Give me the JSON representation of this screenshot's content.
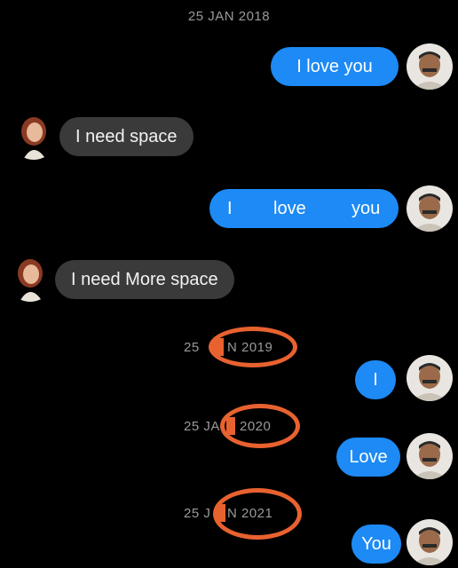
{
  "timestamps": {
    "t2018": "25 JAN 2018",
    "t2019_left": "25",
    "t2019_right": "N 2019",
    "t2020_left": "25 JA",
    "t2020_right": "2020",
    "t2021_left": "25 J",
    "t2021_right": "N 2021"
  },
  "messages": {
    "m1": "I love you",
    "m2": "I need space",
    "m3_a": "I",
    "m3_b": "love",
    "m3_c": "you",
    "m4": "I need More space",
    "m5": "I",
    "m6": "Love",
    "m7": "You"
  },
  "colors": {
    "outgoing": "#1d8af5",
    "incoming": "#3a3a3a",
    "annotation": "#e8622f"
  },
  "icons": {
    "sender": "man-avatar-icon",
    "receiver": "woman-bitmoji-avatar-icon"
  }
}
